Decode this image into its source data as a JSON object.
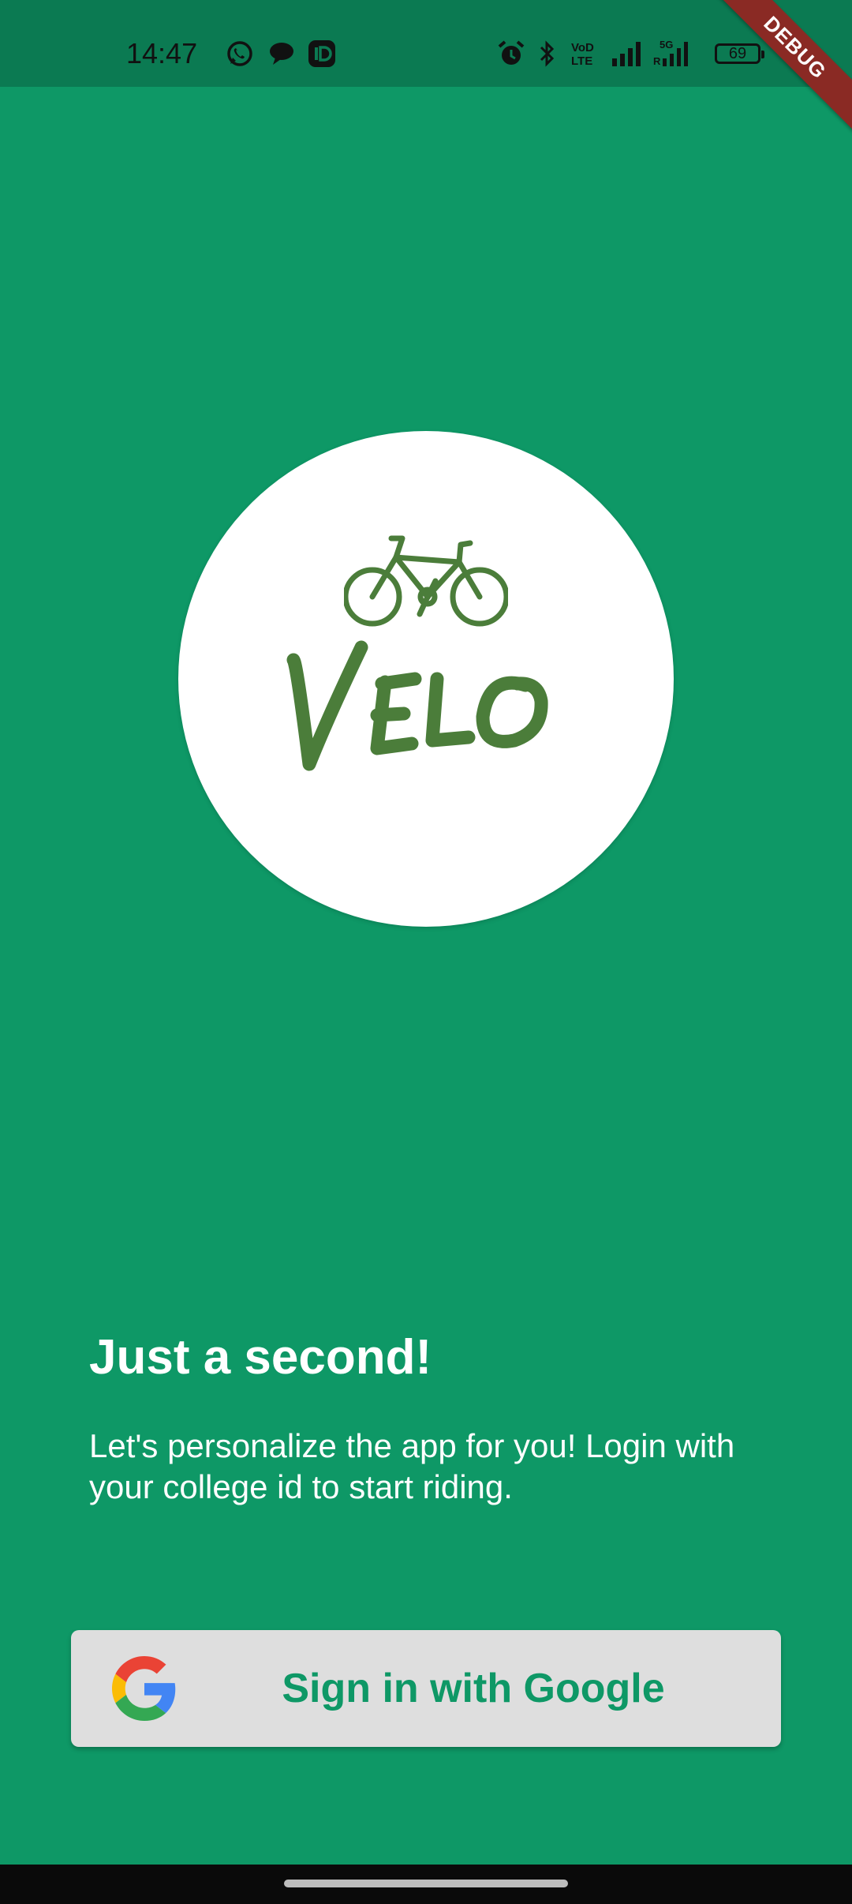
{
  "status_bar": {
    "time": "14:47",
    "battery": "69",
    "icons": [
      "whatsapp-icon",
      "chat-bubble-icon",
      "id-app-icon",
      "alarm-icon",
      "bluetooth-icon",
      "volte-icon",
      "signal-icon",
      "5g-signal-icon",
      "battery-icon"
    ]
  },
  "debug_banner": "DEBUG",
  "logo": {
    "wordmark": "VELO",
    "color": "#4b7d3a"
  },
  "main": {
    "heading": "Just a second!",
    "description": "Let's personalize the app for you! Login with your college id to start riding."
  },
  "sign_in_button": {
    "label": "Sign in with Google",
    "icon": "google-g-icon"
  },
  "colors": {
    "background": "#0e9866",
    "status_bar": "#0b7a52",
    "button_background": "#dedede",
    "button_text": "#0e9866"
  }
}
